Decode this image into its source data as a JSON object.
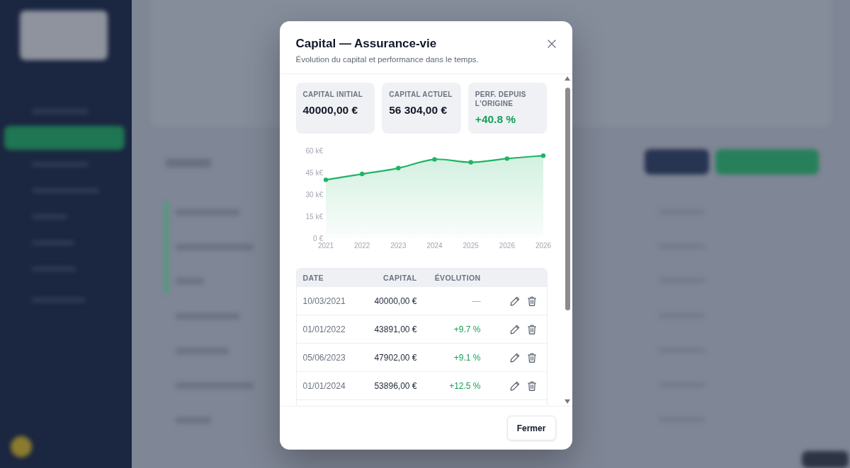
{
  "modal": {
    "title": "Capital — Assurance-vie",
    "subtitle": "Évolution du capital et performance dans le temps.",
    "stats": [
      {
        "label": "CAPITAL INITIAL",
        "value": "40000,00 €",
        "positive": false
      },
      {
        "label": "CAPITAL ACTUEL",
        "value": "56 304,00 €",
        "positive": false
      },
      {
        "label": "PERF. DEPUIS L'ORIGINE",
        "value": "+40.8 %",
        "positive": true
      }
    ],
    "chart_data": {
      "type": "line",
      "categories": [
        "2021",
        "2022",
        "2023",
        "2024",
        "2025",
        "2026",
        "2026"
      ],
      "series": [
        {
          "color": "#1fb464",
          "marker": "circle",
          "values": [
            40000,
            44000,
            48000,
            54000,
            52000,
            54500,
            56500
          ]
        }
      ],
      "ylim": [
        0,
        60000
      ],
      "yticks": [
        {
          "value": 0,
          "label": "0 €"
        },
        {
          "value": 15000,
          "label": "15 k€"
        },
        {
          "value": 30000,
          "label": "30 k€"
        },
        {
          "value": 45000,
          "label": "45 k€"
        },
        {
          "value": 60000,
          "label": "60 k€"
        }
      ]
    },
    "table": {
      "columns": [
        "DATE",
        "CAPITAL",
        "ÉVOLUTION"
      ],
      "rows": [
        {
          "date": "10/03/2021",
          "capital": "40000,00 €",
          "evolution": "—",
          "positive": false
        },
        {
          "date": "01/01/2022",
          "capital": "43891,00 €",
          "evolution": "+9.7 %",
          "positive": true
        },
        {
          "date": "05/06/2023",
          "capital": "47902,00 €",
          "evolution": "+9.1 %",
          "positive": true
        },
        {
          "date": "01/01/2024",
          "capital": "53896,00 €",
          "evolution": "+12.5 %",
          "positive": true
        }
      ]
    },
    "close_button": "Fermer"
  }
}
